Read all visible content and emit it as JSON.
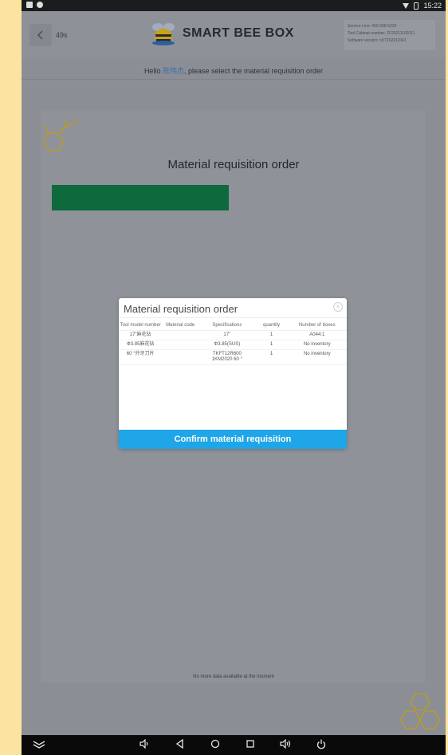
{
  "status_bar": {
    "time": "15:22"
  },
  "header": {
    "countdown": "49s",
    "brand_name": "SMART BEE BOX",
    "info_lines": [
      "Service Line: 400-008-5225",
      "Tool Cabinet number: ZF20211102011",
      "Software version: nV7202211041"
    ]
  },
  "greeting": {
    "prefix": "Hello ",
    "username": "陈伟杰",
    "suffix": ", please select the material requisition order"
  },
  "page": {
    "title": "Material requisition order",
    "empty_text": "No more data available at the moment"
  },
  "dialog": {
    "title": "Material requisition order",
    "columns": [
      "Tool model number",
      "Material code",
      "Specifications",
      "quantity",
      "Number of boxes"
    ],
    "rows": [
      {
        "model": "17\"麻花钻",
        "code": "",
        "spec": "17\"",
        "qty": "1",
        "boxes": "A044:1"
      },
      {
        "model": "Φ3.85麻花钻",
        "code": "",
        "spec": "Φ3.85(SUS)",
        "qty": "1",
        "boxes": "No inventory"
      },
      {
        "model": "60 °外牙刀片",
        "code": "",
        "spec": "TKFT12R600 1KM2020 60 °",
        "qty": "1",
        "boxes": "No inventory"
      }
    ],
    "confirm_label": "Confirm material requisition"
  },
  "colors": {
    "accent": "#1ea6e8",
    "green_bar": "#0e6a3d",
    "hex_logo": "#c9a21a"
  },
  "icons": [
    "back-arrow-icon",
    "bee-logo-icon",
    "close-icon",
    "hexagon-icon",
    "wifi-icon",
    "battery-icon",
    "screenshot-icon",
    "back-icon",
    "home-icon",
    "recents-icon",
    "volume-icon",
    "power-icon",
    "collapse-icon"
  ]
}
